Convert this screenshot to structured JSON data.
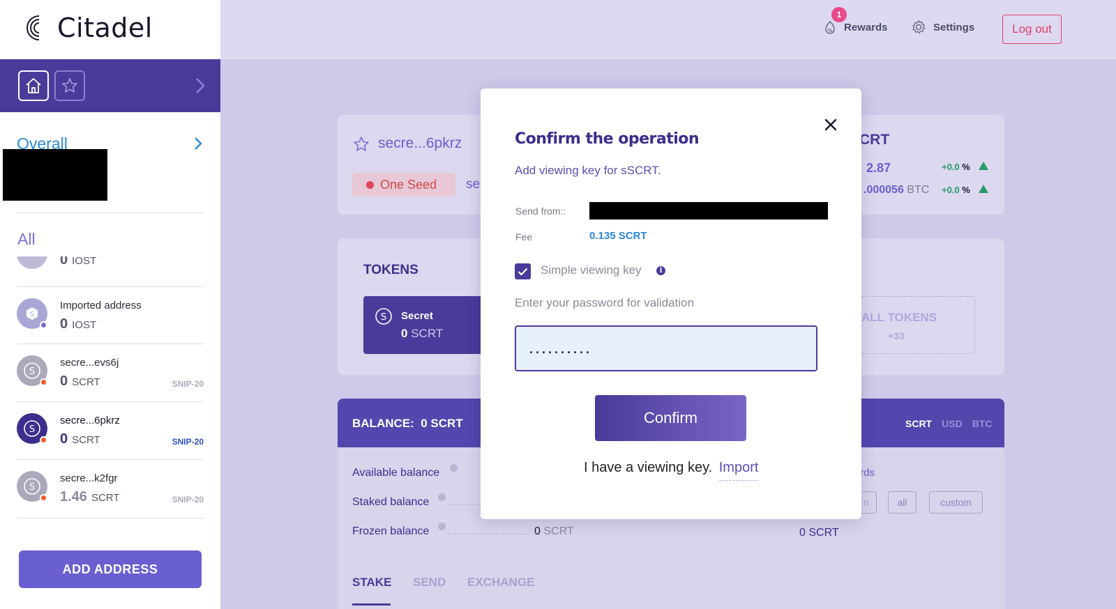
{
  "app": {
    "name": "Citadel"
  },
  "sidebar": {
    "overall_label": "Overall",
    "all_label": "All",
    "partial_item": {
      "amount": "0",
      "unit": "IOST"
    },
    "items": [
      {
        "name": "Imported address",
        "amount": "0",
        "unit": "IOST",
        "tag": "",
        "avatar_color": "#a9a6d6",
        "dot_color": "#7b70d6",
        "selected": false
      },
      {
        "name": "secre...evs6j",
        "amount": "0",
        "unit": "SCRT",
        "tag": "SNIP-20",
        "avatar_color": "#a9a9bb",
        "dot_color": "#f05a28",
        "selected": false
      },
      {
        "name": "secre...6pkrz",
        "amount": "0",
        "unit": "SCRT",
        "tag": "SNIP-20",
        "avatar_color": "#3b2e8c",
        "dot_color": "#f05a28",
        "selected": true
      },
      {
        "name": "secre...k2fgr",
        "amount": "1.46",
        "unit": "SCRT",
        "tag": "SNIP-20",
        "avatar_color": "#a9a9bb",
        "dot_color": "#f05a28",
        "selected": false
      }
    ],
    "add_address_label": "ADD ADDRESS"
  },
  "topbar": {
    "rewards_label": "Rewards",
    "rewards_badge": "1",
    "settings_label": "Settings",
    "logout_label": "Log out"
  },
  "wallet": {
    "address_short": "secre...6pkrz",
    "seed_badge": "One Seed",
    "address_prefix": "se",
    "currency_title": "CRT",
    "price_usd": "2.87",
    "price_usd_change": "+0.0",
    "price_btc": ".000056",
    "price_btc_unit": "BTC",
    "price_btc_change": "+0.0",
    "percent_sign": "%"
  },
  "tokens": {
    "heading": "TOKENS",
    "card": {
      "name": "Secret",
      "amount": "0",
      "unit": "SCRT"
    },
    "all_tokens_label": "ALL TOKENS",
    "all_tokens_count": "+33"
  },
  "balance": {
    "label": "BALANCE:",
    "value": "0 SCRT",
    "currency_tabs": [
      "SCRT",
      "USD",
      "BTC"
    ],
    "rows": [
      {
        "label": "Available balance"
      },
      {
        "label": "Staked balance"
      },
      {
        "label": "Frozen balance",
        "amount": "0",
        "unit": "SCRT"
      }
    ],
    "right_heading_partial": "wards",
    "right_buttons": [
      "n",
      "all",
      "custom"
    ],
    "right_value": "0 SCRT",
    "tabs": [
      "STAKE",
      "SEND",
      "EXCHANGE"
    ]
  },
  "modal": {
    "title": "Confirm the operation",
    "subtitle": "Add viewing key for sSCRT.",
    "send_from_label": "Send from::",
    "fee_label": "Fee",
    "fee_value": "0.135 SCRT",
    "simple_key_label": "Simple viewing key",
    "simple_key_checked": true,
    "password_label": "Enter your password for validation",
    "password_value": "..........",
    "confirm_label": "Confirm",
    "have_key_text": "I have a viewing key.",
    "import_label": "Import"
  }
}
